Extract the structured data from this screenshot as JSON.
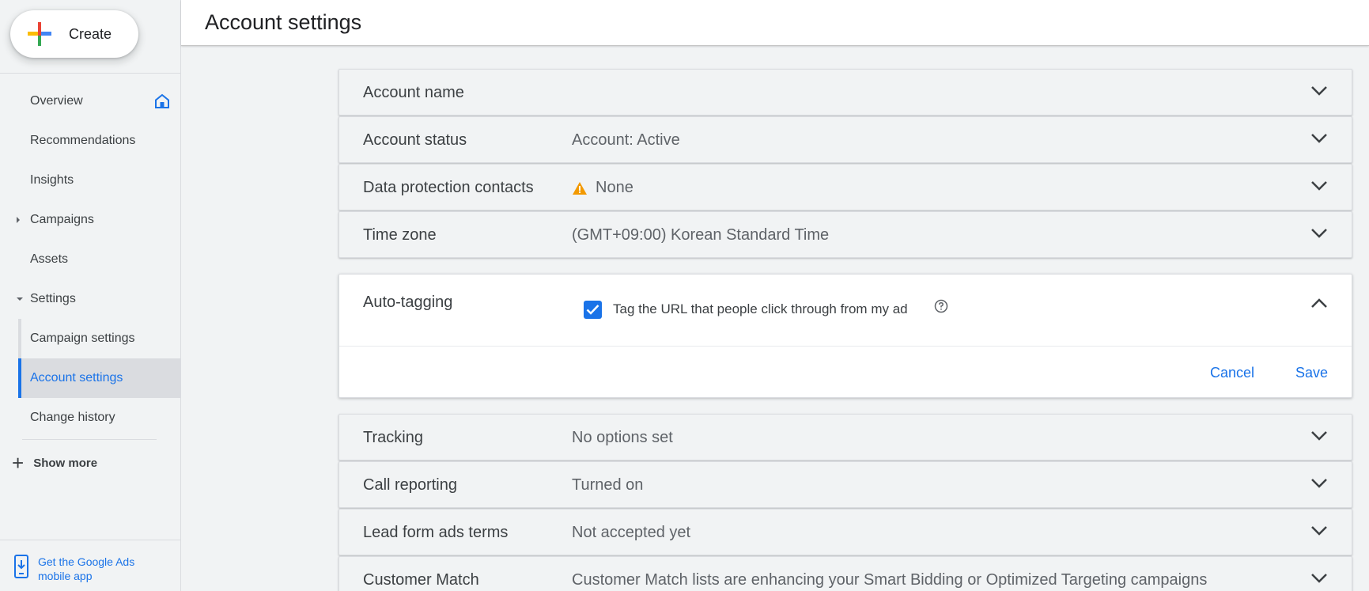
{
  "sidebar": {
    "create_label": "Create",
    "items": [
      {
        "label": "Overview"
      },
      {
        "label": "Recommendations"
      },
      {
        "label": "Insights"
      },
      {
        "label": "Campaigns"
      },
      {
        "label": "Assets"
      },
      {
        "label": "Settings"
      },
      {
        "label": "Campaign settings"
      },
      {
        "label": "Account settings"
      },
      {
        "label": "Change history"
      }
    ],
    "show_more": "Show more",
    "mobile_app": "Get the Google Ads mobile app"
  },
  "header": {
    "title": "Account settings"
  },
  "settings": [
    {
      "label": "Account name",
      "value": ""
    },
    {
      "label": "Account status",
      "value": "Account: Active"
    },
    {
      "label": "Data protection contacts",
      "value": "None"
    },
    {
      "label": "Time zone",
      "value": "(GMT+09:00) Korean Standard Time"
    }
  ],
  "auto_tagging": {
    "label": "Auto-tagging",
    "checkbox_label": "Tag the URL that people click through from my ad",
    "checked": true,
    "cancel": "Cancel",
    "save": "Save"
  },
  "settings_more": [
    {
      "label": "Tracking",
      "value": "No options set"
    },
    {
      "label": "Call reporting",
      "value": "Turned on"
    },
    {
      "label": "Lead form ads terms",
      "value": "Not accepted yet"
    },
    {
      "label": "Customer Match",
      "value": "Customer Match lists are enhancing your Smart Bidding or Optimized Targeting campaigns"
    }
  ],
  "colors": {
    "accent": "#1a73e8",
    "warning": "#f29900"
  }
}
